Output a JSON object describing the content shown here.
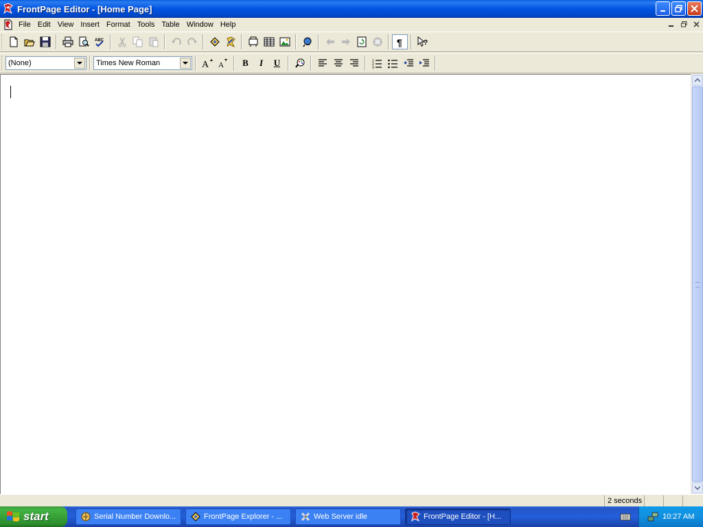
{
  "window": {
    "title": "FrontPage Editor - [Home Page]",
    "accent": "#0054e3",
    "close_color": "#c9401d"
  },
  "menubar": {
    "items": [
      "File",
      "Edit",
      "View",
      "Insert",
      "Format",
      "Tools",
      "Table",
      "Window",
      "Help"
    ]
  },
  "toolbar": {
    "style_select": "(None)",
    "font_select": "Times New Roman",
    "icons": [
      "new-icon",
      "open-icon",
      "save-icon",
      "print-icon",
      "print-preview-icon",
      "spelling-icon",
      "cut-icon",
      "copy-icon",
      "paste-icon",
      "undo-icon",
      "redo-icon",
      "webbot-icon",
      "explorer-icon",
      "to-do-list-icon",
      "table-icon",
      "image-icon",
      "hyperlink-icon",
      "back-icon",
      "forward-icon",
      "refresh-icon",
      "stop-icon",
      "show-paragraphs-icon",
      "help-icon"
    ],
    "format_labels": {
      "bold": "B",
      "italic": "I",
      "underline": "U"
    }
  },
  "status": {
    "timing": "2 seconds"
  },
  "taskbar": {
    "start_label": "start",
    "tasks": [
      {
        "label": "Serial Number Downlo..."
      },
      {
        "label": "FrontPage Explorer - ..."
      },
      {
        "label": "Web Server idle"
      },
      {
        "label": "FrontPage Editor - [H..."
      }
    ],
    "clock": "10:27 AM"
  }
}
